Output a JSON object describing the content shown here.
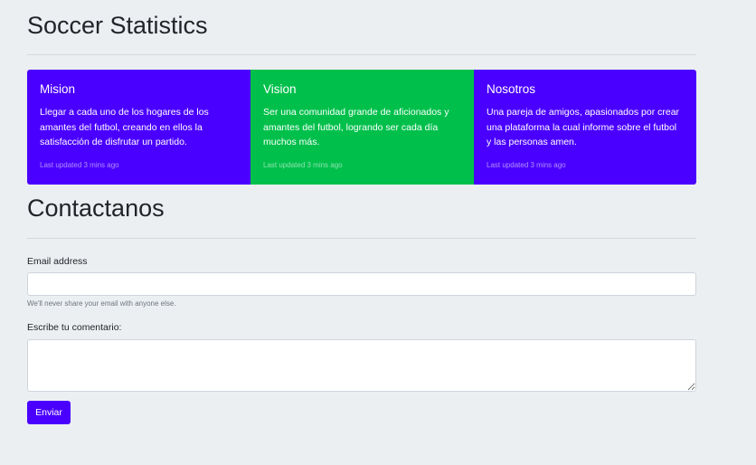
{
  "header": {
    "title": "Soccer Statistics"
  },
  "cards": [
    {
      "title": "Mision",
      "text": "Llegar a cada uno de los hogares de los amantes del futbol, creando en ellos la satisfacción de disfrutar un partido.",
      "footer": "Last updated 3 mins ago",
      "color": "#4a00ff"
    },
    {
      "title": "Vision",
      "text": "Ser una comunidad grande de aficionados y amantes del futbol, logrando ser cada día muchos más.",
      "footer": "Last updated 3 mins ago",
      "color": "#00c04b"
    },
    {
      "title": "Nosotros",
      "text": "Una pareja de amigos, apasionados por crear una plataforma la cual informe sobre el futbol y las personas amen.",
      "footer": "Last updated 3 mins ago",
      "color": "#4a00ff"
    }
  ],
  "contact": {
    "title": "Contactanos",
    "email_label": "Email address",
    "email_value": "",
    "email_placeholder": "",
    "email_help": "We'll never share your email with anyone else.",
    "comment_label": "Escribe tu comentario:",
    "comment_value": "",
    "submit_label": "Enviar",
    "submit_color": "#4a00ff"
  }
}
